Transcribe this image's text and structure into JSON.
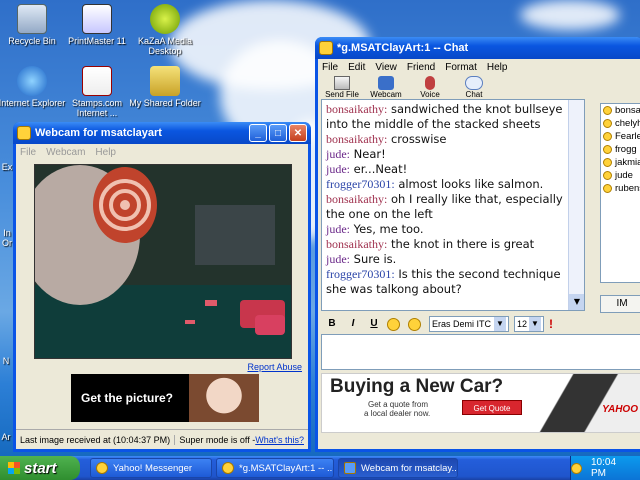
{
  "desktop": {
    "icons": [
      {
        "label": "Recycle Bin"
      },
      {
        "label": "PrintMaster 11"
      },
      {
        "label": "KaZaA Media Desktop"
      },
      {
        "label": "Internet Explorer"
      },
      {
        "label": "Stamps.com Internet ..."
      },
      {
        "label": "My Shared Folder"
      }
    ],
    "edge_fragments": [
      "Ex",
      "In",
      "Or",
      "N",
      "Ar"
    ]
  },
  "webcam_window": {
    "title": "Webcam for msatclayart",
    "menu": [
      "File",
      "Webcam",
      "Help"
    ],
    "report_abuse": "Report Abuse",
    "ad_text": "Get the picture?",
    "status_left": "Last image received at (10:04:37 PM)",
    "status_mode": "Super mode is off - ",
    "status_link": "What's this?"
  },
  "chat_window": {
    "title": "*g.MSATClayArt:1 -- Chat",
    "menu": [
      "File",
      "Edit",
      "View",
      "Friend",
      "Format",
      "Help"
    ],
    "toolbar": [
      {
        "label": "Send File",
        "icon": "send-file-icon"
      },
      {
        "label": "Webcam",
        "icon": "webcam-icon"
      },
      {
        "label": "Voice",
        "icon": "microphone-icon"
      },
      {
        "label": "Chat",
        "icon": "chat-bubbles-icon"
      }
    ],
    "messages": [
      {
        "name": "",
        "text": "sandwiched the knot bullseye into the middle of the stacked sheets",
        "name_prefix": "bonsaikathy:"
      },
      {
        "name_prefix": "bonsaikathy:",
        "text": "crosswise"
      },
      {
        "name_prefix": "jude:",
        "text": "Near!"
      },
      {
        "name_prefix": "jude:",
        "text": "er...Neat!"
      },
      {
        "name_prefix": "frogger70301:",
        "text": "almost looks like salmon."
      },
      {
        "name_prefix": "bonsaikathy:",
        "text": "oh I really like that, especially the one on the left"
      },
      {
        "name_prefix": "jude:",
        "text": "Yes, me too."
      },
      {
        "name_prefix": "bonsaikathy:",
        "text": "the knot in there is great"
      },
      {
        "name_prefix": "jude:",
        "text": "Sure is."
      },
      {
        "name_prefix": "frogger70301:",
        "text": "Is this the second technique she was talkong about?"
      }
    ],
    "buddies": [
      "bonsa",
      "chelyh",
      "Fearle",
      "frogg",
      "jakmia",
      "jude",
      "rubens"
    ],
    "im_button": "IM",
    "font_name": "Eras Demi ITC",
    "font_size": "12",
    "ad": {
      "headline": "Buying a New Car?",
      "sub1": "Get a quote from",
      "sub2": "a local dealer now.",
      "button": "Get Quote",
      "brand": "YAHOO"
    }
  },
  "taskbar": {
    "start": "start",
    "tasks": [
      "Yahoo! Messenger",
      "*g.MSATClayArt:1 -- ...",
      "Webcam for msatclay..."
    ],
    "clock": "10:04 PM"
  }
}
